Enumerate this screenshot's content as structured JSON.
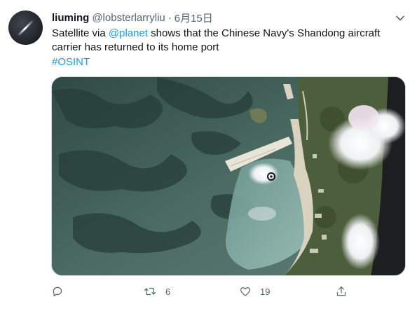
{
  "tweet": {
    "author": {
      "display_name": "liuming",
      "handle": "@lobsterlarryliu",
      "separator": "·",
      "date": "6月15日"
    },
    "text": {
      "part1": "Satellite via ",
      "mention": "@planet",
      "part2": " shows that the Chinese Navy's Shandong aircraft carrier has returned to its home port",
      "hashtag": "#OSINT"
    },
    "media": {
      "description_icon": "satellite-image",
      "marker_icon": "target-marker-icon"
    },
    "actions": {
      "reply": {
        "icon": "reply-icon",
        "count": ""
      },
      "retweet": {
        "icon": "retweet-icon",
        "count": "6"
      },
      "like": {
        "icon": "heart-icon",
        "count": "19"
      },
      "share": {
        "icon": "share-icon"
      }
    },
    "more_icon": "more-chevron-icon"
  },
  "colors": {
    "accent": "#1d9bf0",
    "secondary_text": "#536471",
    "primary_text": "#0f1419"
  }
}
